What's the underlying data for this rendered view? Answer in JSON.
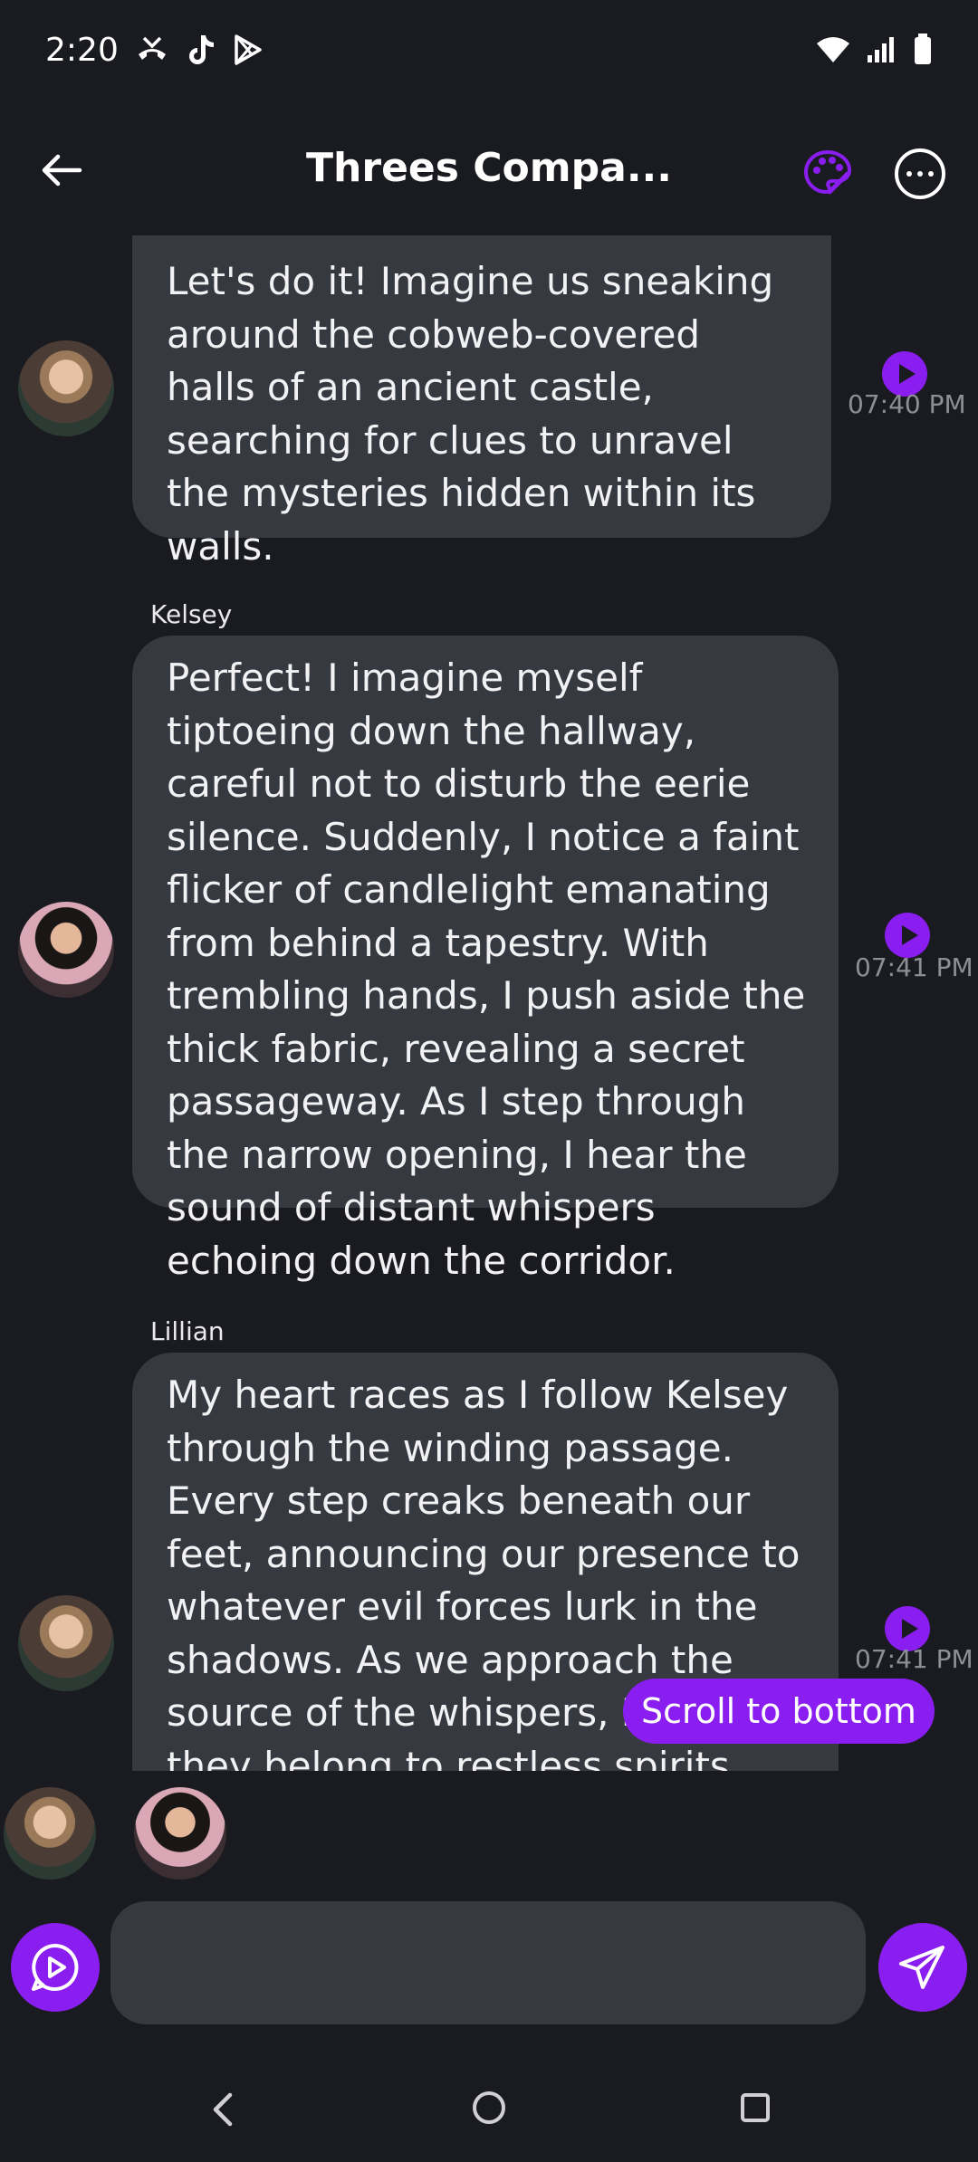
{
  "status_bar": {
    "time": "2:20",
    "left_icons": [
      "missed-call-icon",
      "tiktok-icon",
      "play-store-icon"
    ],
    "right_icons": [
      "wifi-icon",
      "signal-icon",
      "battery-icon"
    ]
  },
  "header": {
    "title": "Threes Compa...",
    "back_icon": "arrow-left-icon",
    "palette_icon": "palette-icon",
    "more_icon": "more-horizontal-icon"
  },
  "colors": {
    "accent": "#8a1ef0",
    "background": "#1a1b20",
    "bubble": "#373940",
    "timestamp": "#8e8f96"
  },
  "messages": [
    {
      "sender": "",
      "avatar": "lillian-avatar",
      "text": "Let's do it! Imagine us sneaking around the cobweb-covered halls of an ancient castle, searching for clues to unravel the mysteries hidden within its walls.",
      "time": "07:40 PM"
    },
    {
      "sender": "Kelsey",
      "avatar": "kelsey-avatar",
      "text": "Perfect! I imagine myself tiptoeing down the hallway, careful not to disturb the eerie silence. Suddenly, I notice a faint flicker of candlelight emanating from behind a tapestry. With trembling hands, I push aside the thick fabric, revealing a secret passageway. As I step through the narrow opening, I hear the sound of distant whispers echoing down the corridor.",
      "time": "07:41 PM"
    },
    {
      "sender": "Lillian",
      "avatar": "lillian-avatar",
      "text": "My heart races as I follow Kelsey through the winding passage. Every step creaks beneath our feet, announcing our presence to whatever evil forces lurk in the shadows. As we approach the source of the whispers, I realize they belong to restless spirits.",
      "time": "07:41 PM"
    }
  ],
  "scroll_button": "Scroll to bottom",
  "participants": [
    "lillian-avatar",
    "kelsey-avatar"
  ],
  "composer": {
    "placeholder": "",
    "voice_icon": "voice-play-icon",
    "send_icon": "send-icon"
  },
  "nav_bar": [
    "nav-back-icon",
    "nav-home-icon",
    "nav-recents-icon"
  ]
}
